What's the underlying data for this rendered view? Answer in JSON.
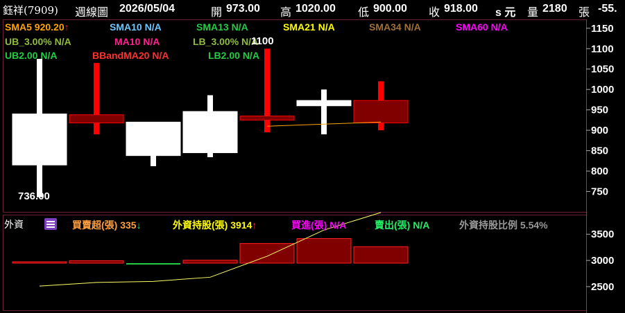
{
  "header": {
    "stock": "鈺祥(7909)",
    "period": "週線圖",
    "date": "2026/05/04",
    "open_label": "開",
    "open": "973.00",
    "high_label": "高",
    "high": "1020.00",
    "low_label": "低",
    "low": "900.00",
    "close_label": "收",
    "close": "918.00",
    "unit": "s 元",
    "volume_label": "量",
    "volume": "2180",
    "volume_unit": "張",
    "change": "-55."
  },
  "indicators": [
    {
      "label": "SMA5",
      "value": "920.20",
      "arrow": "up",
      "color": "#ffa500"
    },
    {
      "label": "SMA10",
      "value": "N/A",
      "color": "#6ec6ff"
    },
    {
      "label": "SMA13",
      "value": "N/A",
      "color": "#22cc44"
    },
    {
      "label": "SMA21",
      "value": "N/A",
      "color": "#ffff00"
    },
    {
      "label": "SMA34",
      "value": "N/A",
      "color": "#a0703a"
    },
    {
      "label": "SMA60",
      "value": "N/A",
      "color": "#ff00ff"
    },
    {
      "label": "UB_3.00%",
      "value": "N/A",
      "color": "#8fbc3f"
    },
    {
      "label": "MA10",
      "value": "N/A",
      "color": "#ff2090"
    },
    {
      "label": "LB_3.00%",
      "value": "N/A",
      "color": "#8fbc3f"
    },
    {
      "label": "UB2.00",
      "value": "N/A",
      "color": "#22cc44"
    },
    {
      "label": "BBandMA20",
      "value": "N/A",
      "color": "#ff3030"
    },
    {
      "label": "LB2.00",
      "value": "N/A",
      "color": "#22cc44"
    }
  ],
  "lower_panel": {
    "title": "外資",
    "items": [
      {
        "label": "買賣超(張)",
        "value": "335",
        "arrow": "down",
        "color": "#ffa040"
      },
      {
        "label": "外資持股(張)",
        "value": "3914",
        "arrow": "up",
        "color": "#ffff00"
      },
      {
        "label": "買進(張)",
        "value": "N/A",
        "color": "#ff00ff"
      },
      {
        "label": "賣出(張)",
        "value": "N/A",
        "color": "#22ee66"
      },
      {
        "label": "外資持股比例",
        "value": "5.54%",
        "color": "#999999"
      }
    ]
  },
  "chart_data": [
    {
      "type": "candlestick",
      "y_ticks": [
        750,
        800,
        850,
        900,
        950,
        1000,
        1050,
        1100,
        1150
      ],
      "ylim": [
        700,
        1170
      ],
      "candles": [
        {
          "open": 940,
          "high": 1075,
          "low": 736,
          "close": 815
        },
        {
          "open": 918,
          "high": 1065,
          "low": 890,
          "close": 938
        },
        {
          "open": 920,
          "high": 920,
          "low": 812,
          "close": 838
        },
        {
          "open": 946,
          "high": 986,
          "low": 834,
          "close": 845
        },
        {
          "open": 925,
          "high": 1100,
          "low": 895,
          "close": 935
        },
        {
          "open": 973,
          "high": 1000,
          "low": 890,
          "close": 960
        },
        {
          "open": 918,
          "high": 1020,
          "low": 900,
          "close": 973
        }
      ],
      "sma5": [
        null,
        null,
        null,
        null,
        910,
        915,
        920.2
      ],
      "annotations": {
        "max": "1100",
        "min": "736.00"
      }
    },
    {
      "type": "bar+line",
      "y_ticks": [
        2500,
        3000,
        3500
      ],
      "ylim": [
        2050,
        3860
      ],
      "net_buy": [
        10,
        50,
        -10,
        60,
        400,
        500,
        335
      ],
      "holdings": [
        2510,
        2580,
        2600,
        2680,
        3080,
        3580,
        3914
      ]
    }
  ],
  "colors": {
    "up": "#ff0000",
    "down": "#ffffff",
    "bar": "#800000",
    "frame": "#6b1e3a"
  }
}
